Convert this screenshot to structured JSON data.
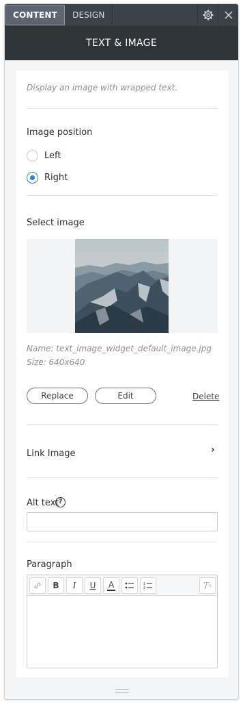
{
  "tabs": {
    "content": "CONTENT",
    "design": "DESIGN"
  },
  "header": {
    "title": "TEXT & IMAGE"
  },
  "description": "Display an image with wrapped text.",
  "image_position": {
    "label": "Image position",
    "options": [
      "Left",
      "Right"
    ],
    "selected": "Right"
  },
  "select_image": {
    "label": "Select image",
    "name": "Name: text_image_widget_default_image.jpg",
    "size": "Size: 640x640"
  },
  "buttons": {
    "replace": "Replace",
    "edit": "Edit",
    "delete": "Delete"
  },
  "link_image": {
    "label": "Link Image"
  },
  "alt_text": {
    "label": "Alt text",
    "help": "?",
    "value": "",
    "placeholder": ""
  },
  "paragraph": {
    "label": "Paragraph",
    "toolbar": [
      "link-icon",
      "bold-icon",
      "italic-icon",
      "underline-icon",
      "text-color-icon",
      "bulleted-list-icon",
      "numbered-list-icon",
      "clear-format-icon"
    ]
  },
  "colors": {
    "accent": "#2f7fd1",
    "tabbar": "#3b4249",
    "header": "#2f3438",
    "panel_bg": "#f4f5f6"
  }
}
